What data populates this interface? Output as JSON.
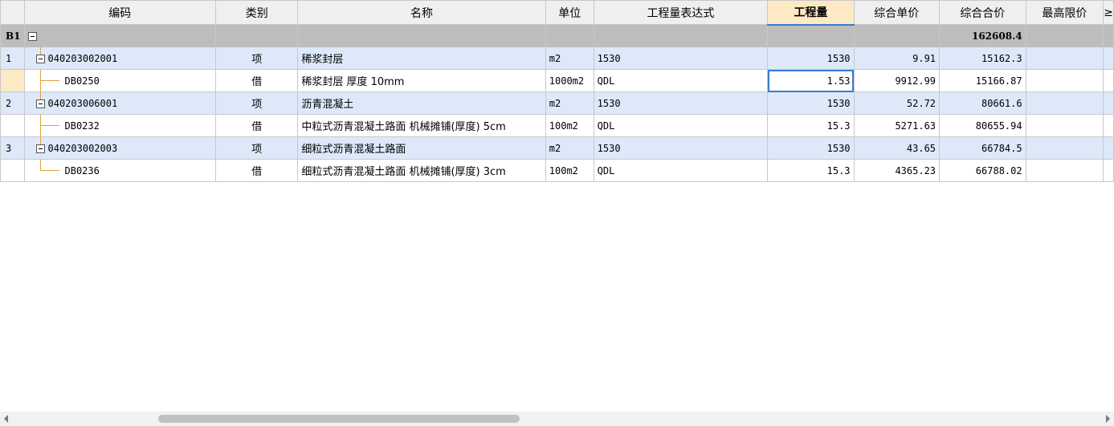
{
  "columns": {
    "code": "编码",
    "type": "类别",
    "name": "名称",
    "unit": "单位",
    "expr": "工程量表达式",
    "qty": "工程量",
    "unit_price": "综合单价",
    "total_price": "综合合价",
    "max_price": "最高限价",
    "extra": "≥"
  },
  "group": {
    "id": "B1",
    "total_price": "162608.4"
  },
  "rows": [
    {
      "num": "1",
      "code": "040203002001",
      "type": "项",
      "name": "稀浆封层",
      "unit": "m2",
      "expr": "1530",
      "qty": "1530",
      "unit_price": "9.91",
      "total_price": "15162.3"
    },
    {
      "num": "",
      "code": "DB0250",
      "type": "借",
      "name": "稀浆封层 厚度 10mm",
      "unit": "1000m2",
      "expr": "QDL",
      "qty": "1.53",
      "unit_price": "9912.99",
      "total_price": "15166.87"
    },
    {
      "num": "2",
      "code": "040203006001",
      "type": "项",
      "name": "沥青混凝土",
      "unit": "m2",
      "expr": "1530",
      "qty": "1530",
      "unit_price": "52.72",
      "total_price": "80661.6"
    },
    {
      "num": "",
      "code": "DB0232",
      "type": "借",
      "name": "中粒式沥青混凝土路面 机械摊铺(厚度) 5cm",
      "unit": "100m2",
      "expr": "QDL",
      "qty": "15.3",
      "unit_price": "5271.63",
      "total_price": "80655.94"
    },
    {
      "num": "3",
      "code": "040203002003",
      "type": "项",
      "name": "细粒式沥青混凝土路面",
      "unit": "m2",
      "expr": "1530",
      "qty": "1530",
      "unit_price": "43.65",
      "total_price": "66784.5"
    },
    {
      "num": "",
      "code": "DB0236",
      "type": "借",
      "name": "细粒式沥青混凝土路面 机械摊铺(厚度) 3cm",
      "unit": "100m2",
      "expr": "QDL",
      "qty": "15.3",
      "unit_price": "4365.23",
      "total_price": "66788.02"
    }
  ]
}
